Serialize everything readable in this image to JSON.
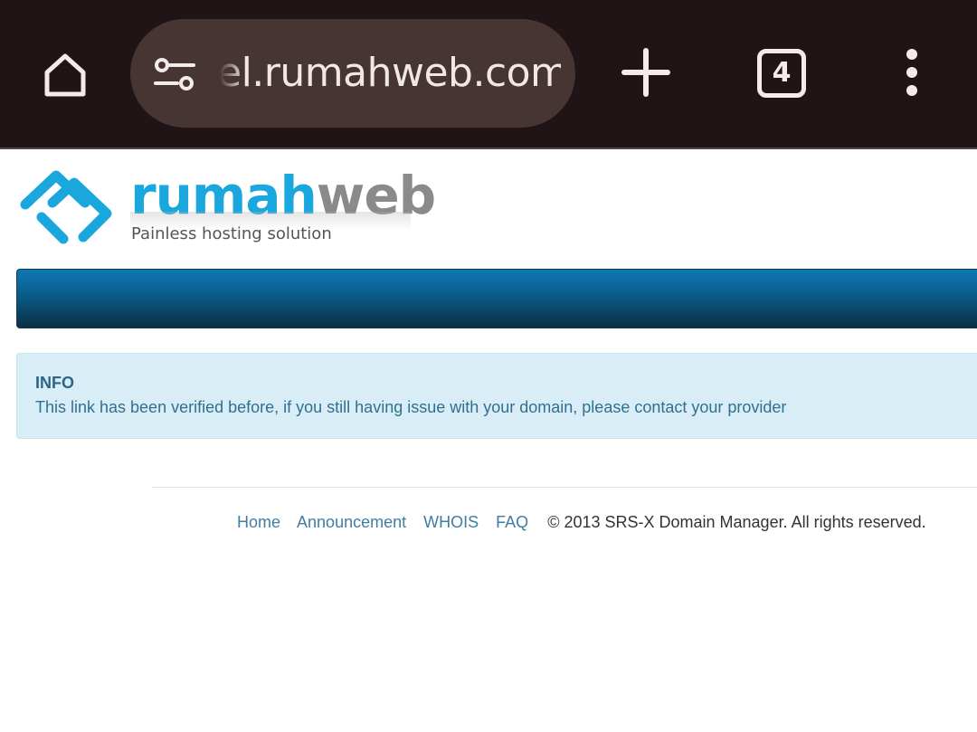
{
  "browser": {
    "url_text": "el.rumahweb.com",
    "tab_count": "4",
    "icons": {
      "home": "home-icon",
      "site_settings": "tune-icon",
      "new_tab": "plus-icon",
      "menu": "more-vert-icon"
    }
  },
  "header": {
    "logo_word_blue": "rumah",
    "logo_word_gray": "web",
    "tagline": "Painless hosting solution"
  },
  "alert": {
    "title": "INFO",
    "message": "This link has been verified before, if you still having issue with your domain, please contact your provider"
  },
  "footer": {
    "links": [
      "Home",
      "Announcement",
      "WHOIS",
      "FAQ"
    ],
    "copyright": "© 2013 SRS-X Domain Manager. All rights reserved."
  },
  "colors": {
    "chrome_bg": "#201416",
    "url_pill_bg": "#473534",
    "brand_blue": "#1aa7dd",
    "brand_gray": "#8a8a8a",
    "alert_bg": "#d9edf7",
    "alert_text": "#31708f",
    "link": "#3f7ea3"
  }
}
